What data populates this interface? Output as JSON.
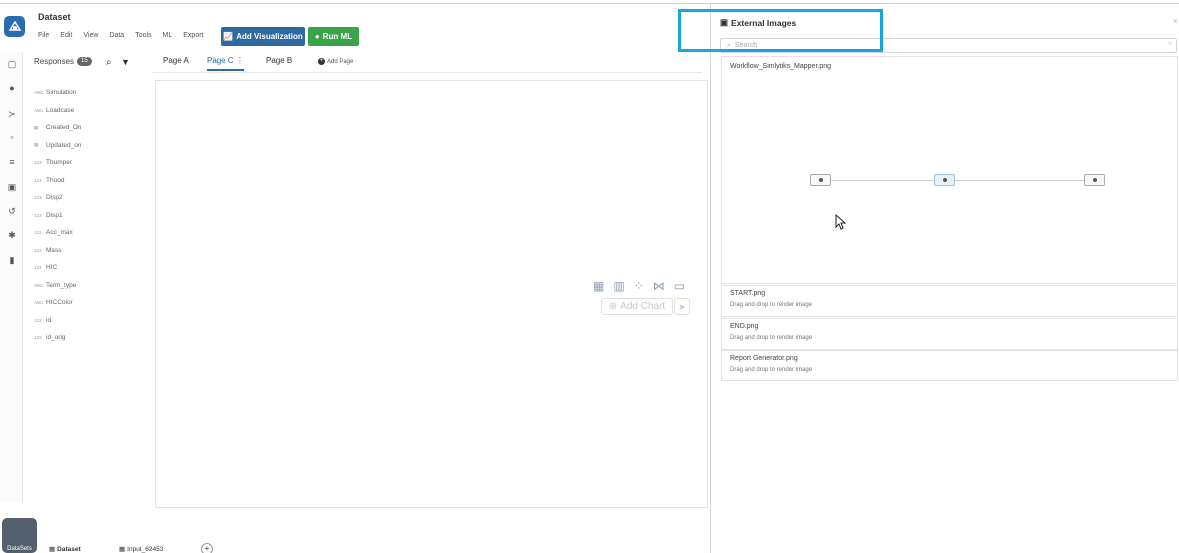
{
  "app": {
    "title": "Dataset"
  },
  "menu": [
    "File",
    "Edit",
    "View",
    "Data",
    "Tools",
    "ML",
    "Export"
  ],
  "toolbar": {
    "add_visualization": "Add Visualization",
    "run_ml": "Run ML"
  },
  "responses": {
    "label": "Responses",
    "count": "15"
  },
  "fields": [
    {
      "type": "ABC",
      "name": "Simulation"
    },
    {
      "type": "ABC",
      "name": "Loadcase"
    },
    {
      "type": "date",
      "name": "Created_On"
    },
    {
      "type": "date",
      "name": "Updated_on"
    },
    {
      "type": "123",
      "name": "Tbumper"
    },
    {
      "type": "123",
      "name": "Thood"
    },
    {
      "type": "123",
      "name": "Disp2"
    },
    {
      "type": "123",
      "name": "Disp1"
    },
    {
      "type": "123",
      "name": "Acc_max"
    },
    {
      "type": "123",
      "name": "Mass"
    },
    {
      "type": "123",
      "name": "HIC"
    },
    {
      "type": "ABC",
      "name": "Term_type"
    },
    {
      "type": "ABC",
      "name": "HICColor"
    },
    {
      "type": "123",
      "name": "id"
    },
    {
      "type": "123",
      "name": "id_orig"
    }
  ],
  "tabs": [
    "Page A",
    "Page C",
    "Page B"
  ],
  "active_tab": "Page C",
  "add_page": "Add Page",
  "add_chart": "Add Chart",
  "bottom": {
    "datasets": "DataSets",
    "tab1": "Dataset",
    "tab2": "Input_62453"
  },
  "panel": {
    "title": "External Images",
    "search_placeholder": "Search",
    "images": [
      {
        "name": "Workflow_Simlytiks_Mapper.png"
      },
      {
        "name": "START.png",
        "placeholder": "Drag and drop to render image"
      },
      {
        "name": "END.png",
        "placeholder": "Drag and drop to render image"
      },
      {
        "name": "Report Generator.png",
        "placeholder": "Drag and drop to render image"
      }
    ]
  },
  "colors": {
    "accent": "#2c6aa0",
    "run_ml": "#3aa34a",
    "highlight": "#17a6e0"
  }
}
